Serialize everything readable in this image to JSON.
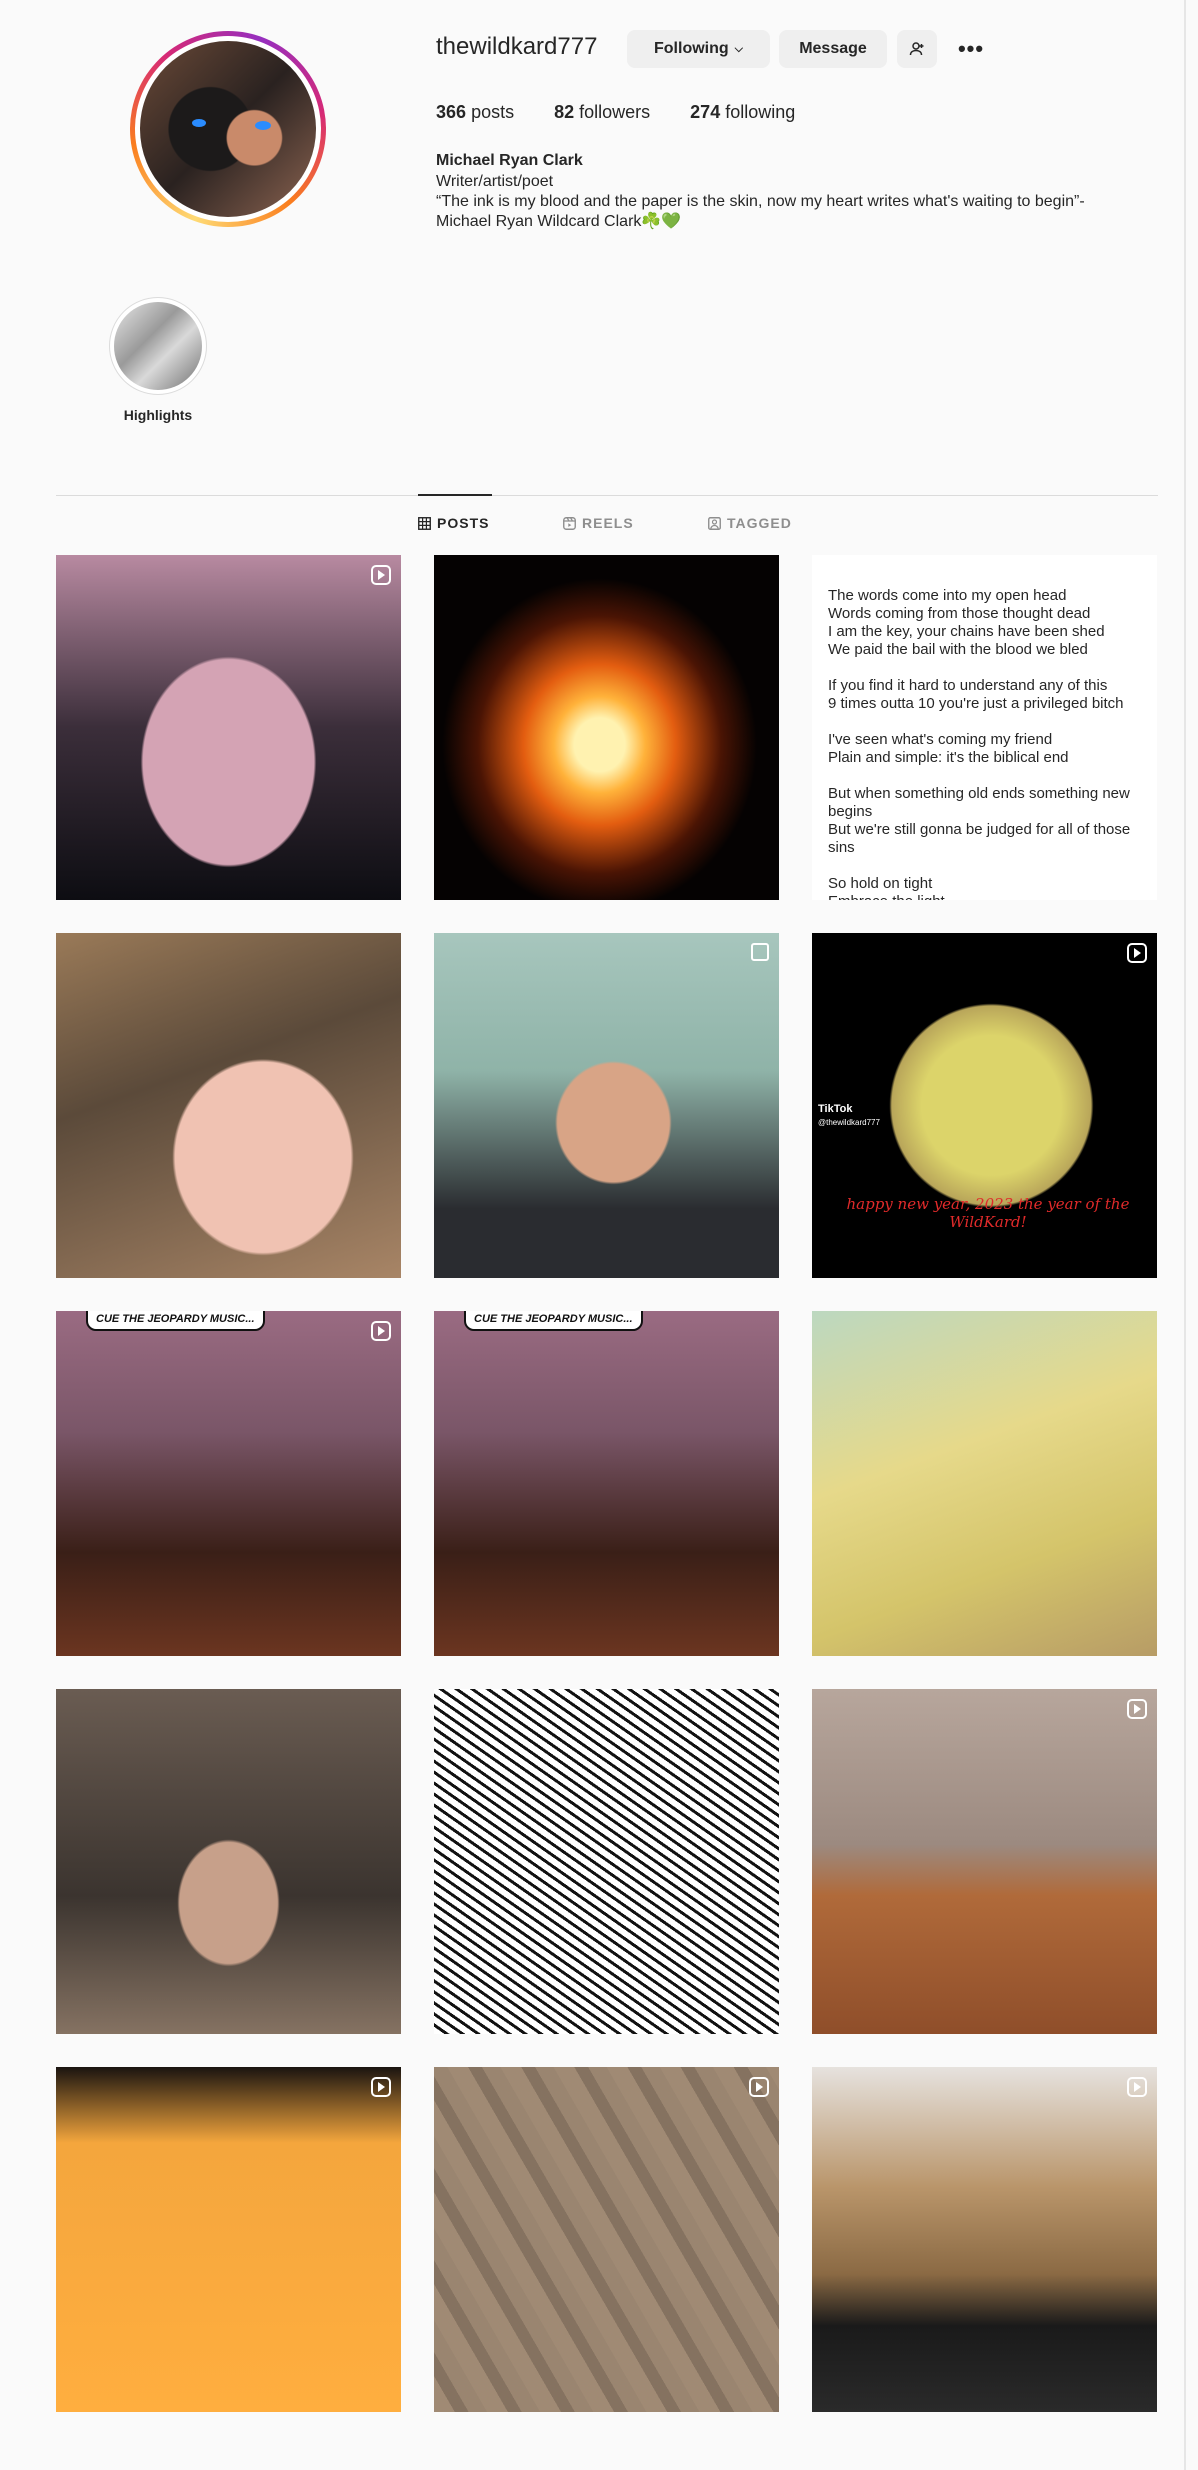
{
  "profile": {
    "username": "thewildkard777",
    "following_label": "Following",
    "following_chevron": "chevron-down-icon",
    "message_label": "Message",
    "add_user_icon": "person-plus-icon",
    "more_icon": "more-horizontal-icon",
    "more_glyph": "•••",
    "posts_count": "366",
    "posts_label": "posts",
    "followers_count": "82",
    "followers_label": "followers",
    "following_count": "274",
    "following_label_stat": "following",
    "full_name": "Michael Ryan Clark",
    "bio": "Writer/artist/poet\n“The ink is my blood and the paper is the skin, now my heart writes what's waiting to begin”-\nMichael Ryan Wildcard Clark☘️💚"
  },
  "highlights": [
    {
      "label": "Highlights"
    }
  ],
  "tabs": [
    {
      "label": "POSTS",
      "icon": "grid-icon",
      "active": true
    },
    {
      "label": "REELS",
      "icon": "reels-icon",
      "active": false
    },
    {
      "label": "TAGGED",
      "icon": "tagged-icon",
      "active": false
    }
  ],
  "posts": [
    {
      "type": "reel"
    },
    {
      "type": "image"
    },
    {
      "type": "text",
      "text": "The words come into my open head\nWords coming from those thought dead\nI am the key, your chains have been shed\nWe paid the bail with the blood we bled\n\nIf you find it hard to understand any of this\n9 times outta 10 you're just a privileged bitch\n\nI've seen what's coming my friend\nPlain and simple: it's the biblical end\n\nBut when something old ends something new begins\nBut we're still gonna be judged for all of those sins\n\nSo hold on tight\nEmbrace the light"
    },
    {
      "type": "image"
    },
    {
      "type": "carousel"
    },
    {
      "type": "reel",
      "tiktok": "TikTok",
      "handle": "@thewildkard777",
      "caption": "happy new year, 2023 the year of the WildKard!"
    },
    {
      "type": "reel",
      "comic": "CUE THE JEOPARDY MUSIC..."
    },
    {
      "type": "image",
      "comic": "CUE THE JEOPARDY MUSIC..."
    },
    {
      "type": "image"
    },
    {
      "type": "image"
    },
    {
      "type": "image"
    },
    {
      "type": "reel"
    },
    {
      "type": "reel"
    },
    {
      "type": "reel"
    },
    {
      "type": "reel"
    }
  ],
  "colors": {
    "background": "#fafafa",
    "button_bg": "#efefef",
    "text": "#262626",
    "muted": "#8e8e8e",
    "story_ring": [
      "#feda75",
      "#fa7e1e",
      "#d62976",
      "#962fbf"
    ]
  }
}
